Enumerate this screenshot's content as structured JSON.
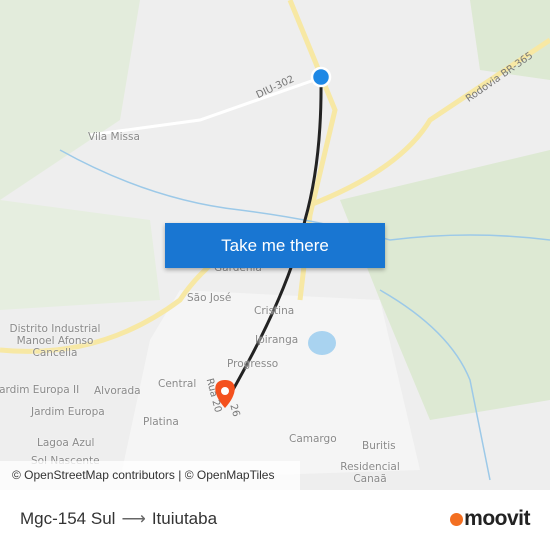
{
  "map": {
    "action_button": "Take me there",
    "attribution": "© OpenStreetMap contributors | © OpenMapTiles",
    "road_labels": [
      "DIU-302",
      "Rodovia BR-365",
      "Rua 20",
      "26"
    ],
    "place_labels": [
      "Vila Missa",
      "Gardênia",
      "São José",
      "Cristina",
      "Ipiranga",
      "Progresso",
      "Central",
      "Alvorada",
      "Jardim Europa II",
      "Jardim Europa",
      "Platina",
      "Lagoa Azul",
      "Sol Nascente",
      "Camargo",
      "Buritis",
      "Residencial Canaã",
      "Distrito Industrial Manoel Afonso Cancella"
    ],
    "origin_marker_color": "#1e88e5",
    "destination_marker_color": "#f4511e"
  },
  "footer": {
    "origin": "Mgc-154 Sul",
    "arrow": "⟶",
    "destination": "Ituiutaba",
    "brand": "moovit",
    "brand_color": "#f36f21"
  }
}
